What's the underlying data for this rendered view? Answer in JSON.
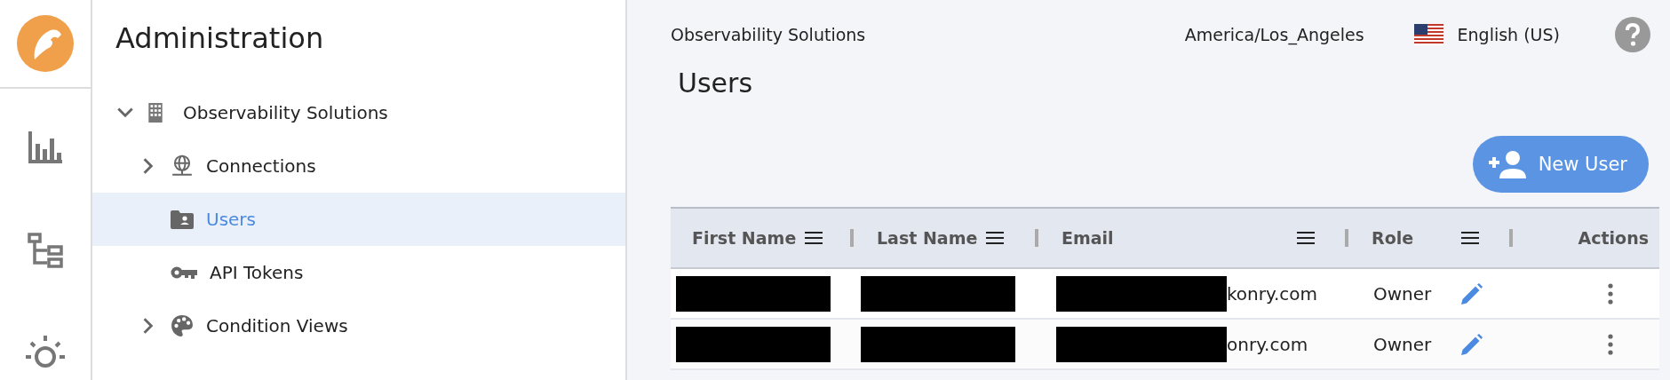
{
  "sidebar": {
    "title": "Administration",
    "tree": [
      {
        "label": "Observability Solutions",
        "kind": "building",
        "expanded": true,
        "selected": false,
        "children": [
          {
            "label": "Connections",
            "kind": "globe",
            "expanded": false,
            "has_children": true,
            "selected": false
          },
          {
            "label": "Users",
            "kind": "folder-user",
            "has_children": false,
            "selected": true
          },
          {
            "label": "API Tokens",
            "kind": "key",
            "has_children": false,
            "selected": false
          },
          {
            "label": "Condition Views",
            "kind": "palette",
            "expanded": false,
            "has_children": true,
            "selected": false
          }
        ]
      }
    ]
  },
  "header": {
    "breadcrumb": "Observability Solutions",
    "timezone": "America/Los_Angeles",
    "language": "English (US)"
  },
  "page": {
    "title": "Users",
    "new_button": "New User"
  },
  "table": {
    "columns": [
      {
        "label": "First Name",
        "kind": "data"
      },
      {
        "label": "Last Name",
        "kind": "data"
      },
      {
        "label": "Email",
        "kind": "data"
      },
      {
        "label": "Role",
        "kind": "data"
      },
      {
        "label": "Actions",
        "kind": "actions"
      }
    ],
    "rows": [
      {
        "first_name": {
          "redacted": true
        },
        "last_name": {
          "redacted": true
        },
        "email": {
          "redacted": true,
          "text": "konry.com"
        },
        "role": "Owner"
      },
      {
        "first_name": {
          "redacted": true
        },
        "last_name": {
          "redacted": true
        },
        "email": {
          "redacted": true,
          "text": "onry.com"
        },
        "role": "Owner"
      }
    ]
  }
}
